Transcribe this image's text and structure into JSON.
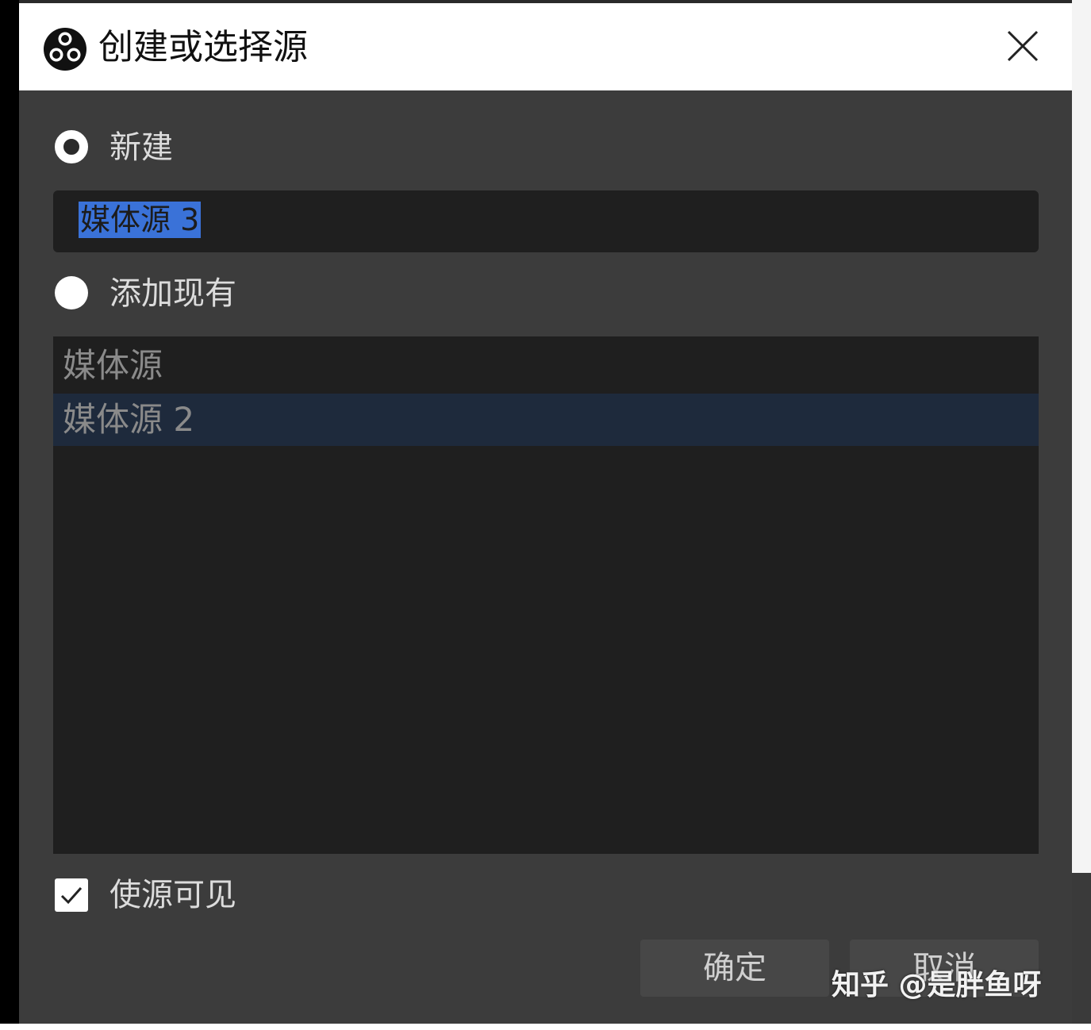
{
  "dialog": {
    "title": "创建或选择源",
    "new_option": {
      "label": "新建",
      "selected": true
    },
    "name_input": {
      "value": "媒体源 3"
    },
    "existing_option": {
      "label": "添加现有",
      "selected": false
    },
    "existing_sources": [
      {
        "label": "媒体源"
      },
      {
        "label": "媒体源 2",
        "selected": true
      }
    ],
    "visible_checkbox": {
      "label": "使源可见",
      "checked": true
    },
    "buttons": {
      "ok": "确定",
      "cancel": "取消"
    }
  },
  "watermark": "知乎 @是胖鱼呀",
  "colors": {
    "background": "#3c3c3c",
    "input_background": "#1f1f1f",
    "selection": "#3a72d8",
    "list_selected": "#1e2a3c",
    "titlebar": "#ffffff"
  },
  "icons": {
    "app": "obs-logo-icon",
    "close": "close-icon",
    "check": "check-icon"
  }
}
